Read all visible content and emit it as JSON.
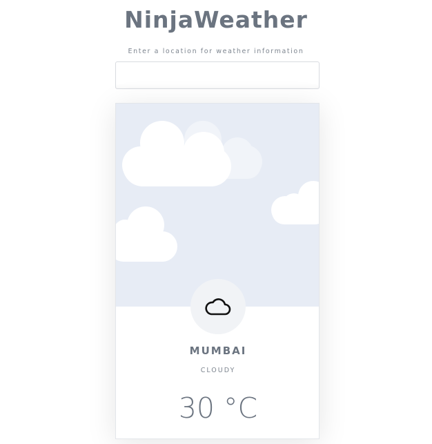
{
  "app": {
    "title": "NinjaWeather"
  },
  "search": {
    "label": "Enter a location for weather information",
    "value": "",
    "placeholder": ""
  },
  "weather": {
    "city": "MUMBAI",
    "condition": "CLOUDY",
    "temperature": "30 °C",
    "icon": "cloud-icon",
    "background": "cloudy-sky"
  },
  "colors": {
    "sky": "#e7ecf5",
    "text": "#6b7480",
    "icon_bg": "#f1f3f6"
  }
}
